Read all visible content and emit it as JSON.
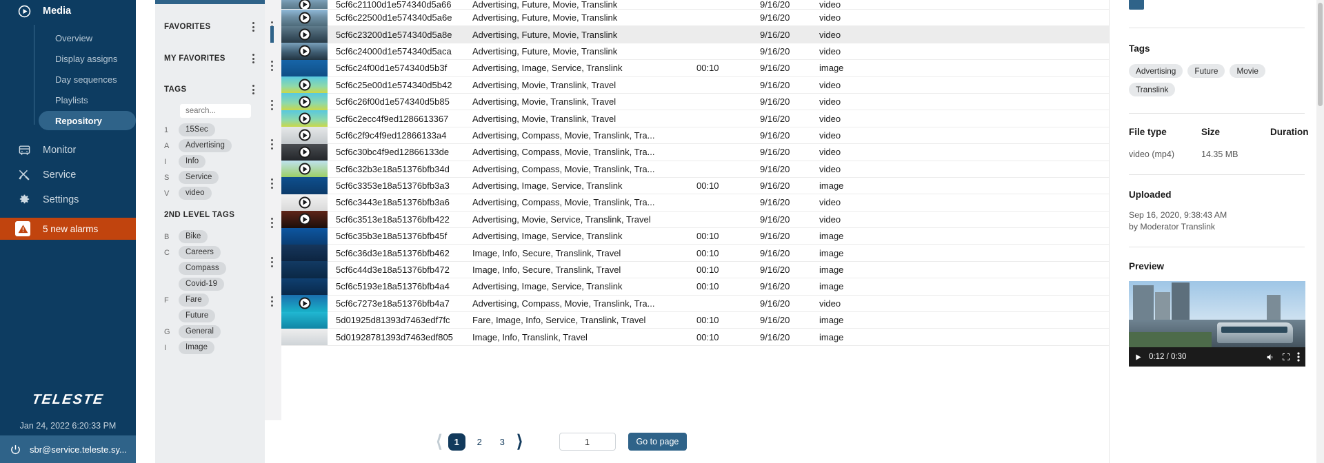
{
  "sidebar": {
    "group": {
      "label": "Media",
      "icon": "play-circle-icon"
    },
    "sub_items": [
      {
        "label": "Overview"
      },
      {
        "label": "Display assigns"
      },
      {
        "label": "Day sequences"
      },
      {
        "label": "Playlists"
      },
      {
        "label": "Repository",
        "active": true
      }
    ],
    "items": [
      {
        "label": "Monitor",
        "icon": "bus-icon"
      },
      {
        "label": "Service",
        "icon": "tools-icon"
      },
      {
        "label": "Settings",
        "icon": "gear-icon"
      }
    ],
    "alarm": {
      "label": "5 new alarms",
      "icon": "warning-icon",
      "color": "#c1440e"
    },
    "brand": "TELESTE",
    "datetime": "Jan 24, 2022  6:20:33 PM",
    "user": "sbr@service.teleste.sy..."
  },
  "tagpanel": {
    "sections": [
      {
        "title": "FAVORITES"
      },
      {
        "title": "MY FAVORITES"
      },
      {
        "title": "TAGS"
      }
    ],
    "search_placeholder": "search...",
    "tags": [
      {
        "letter": "1",
        "label": "15Sec"
      },
      {
        "letter": "A",
        "label": "Advertising"
      },
      {
        "letter": "I",
        "label": "Info"
      },
      {
        "letter": "S",
        "label": "Service"
      },
      {
        "letter": "V",
        "label": "video"
      }
    ],
    "second_level_title": "2ND LEVEL TAGS",
    "second_level_tags": [
      {
        "letter": "B",
        "label": "Bike"
      },
      {
        "letter": "C",
        "label": "Careers"
      },
      {
        "letter": "",
        "label": "Compass"
      },
      {
        "letter": "",
        "label": "Covid-19"
      },
      {
        "letter": "F",
        "label": "Fare"
      },
      {
        "letter": "",
        "label": "Future"
      },
      {
        "letter": "G",
        "label": "General"
      },
      {
        "letter": "I",
        "label": "Image"
      }
    ]
  },
  "list": {
    "rows": [
      {
        "id": "5cf6c21100d1e574340d5a66",
        "tags": "Advertising, Future, Movie, Translink",
        "duration": "",
        "date": "9/16/20",
        "type": "video",
        "thumb": "city-video",
        "selected": false,
        "partial": true
      },
      {
        "id": "5cf6c22500d1e574340d5a6e",
        "tags": "Advertising, Future, Movie, Translink",
        "duration": "",
        "date": "9/16/20",
        "type": "video",
        "thumb": "city-video",
        "selected": false
      },
      {
        "id": "5cf6c23200d1e574340d5a8e",
        "tags": "Advertising, Future, Movie, Translink",
        "duration": "",
        "date": "9/16/20",
        "type": "video",
        "thumb": "bridge-video",
        "selected": true
      },
      {
        "id": "5cf6c24000d1e574340d5aca",
        "tags": "Advertising, Future, Movie, Translink",
        "duration": "",
        "date": "9/16/20",
        "type": "video",
        "thumb": "water-video",
        "selected": false
      },
      {
        "id": "5cf6c24f00d1e574340d5b3f",
        "tags": "Advertising, Image, Service, Translink",
        "duration": "00:10",
        "date": "9/16/20",
        "type": "image",
        "thumb": "blue-poster",
        "selected": false
      },
      {
        "id": "5cf6c25e00d1e574340d5b42",
        "tags": "Advertising, Movie, Translink, Travel",
        "duration": "",
        "date": "9/16/20",
        "type": "video",
        "thumb": "cyan-video",
        "selected": false
      },
      {
        "id": "5cf6c26f00d1e574340d5b85",
        "tags": "Advertising, Movie, Translink, Travel",
        "duration": "",
        "date": "9/16/20",
        "type": "video",
        "thumb": "cyan-video",
        "selected": false
      },
      {
        "id": "5cf6c2ecc4f9ed1286613367",
        "tags": "Advertising, Movie, Translink, Travel",
        "duration": "",
        "date": "9/16/20",
        "type": "video",
        "thumb": "cyan-video",
        "selected": false
      },
      {
        "id": "5cf6c2f9c4f9ed12866133a4",
        "tags": "Advertising, Compass, Movie, Translink, Tra...",
        "duration": "",
        "date": "9/16/20",
        "type": "video",
        "thumb": "grey-video",
        "selected": false
      },
      {
        "id": "5cf6c30bc4f9ed12866133de",
        "tags": "Advertising, Compass, Movie, Translink, Tra...",
        "duration": "",
        "date": "9/16/20",
        "type": "video",
        "thumb": "dark-video",
        "selected": false
      },
      {
        "id": "5cf6c32b3e18a51376bfb34d",
        "tags": "Advertising, Compass, Movie, Translink, Tra...",
        "duration": "",
        "date": "9/16/20",
        "type": "video",
        "thumb": "platform-video",
        "selected": false
      },
      {
        "id": "5cf6c3353e18a51376bfb3a3",
        "tags": "Advertising, Image, Service, Translink",
        "duration": "00:10",
        "date": "9/16/20",
        "type": "image",
        "thumb": "card-poster",
        "selected": false
      },
      {
        "id": "5cf6c3443e18a51376bfb3a6",
        "tags": "Advertising, Compass, Movie, Translink, Tra...",
        "duration": "",
        "date": "9/16/20",
        "type": "video",
        "thumb": "white-video",
        "selected": false
      },
      {
        "id": "5cf6c3513e18a51376bfb422",
        "tags": "Advertising, Movie, Service, Translink, Travel",
        "duration": "",
        "date": "9/16/20",
        "type": "video",
        "thumb": "night-video",
        "selected": false
      },
      {
        "id": "5cf6c35b3e18a51376bfb45f",
        "tags": "Advertising, Image, Service, Translink",
        "duration": "00:10",
        "date": "9/16/20",
        "type": "image",
        "thumb": "map-poster",
        "selected": false
      },
      {
        "id": "5cf6c36d3e18a51376bfb462",
        "tags": "Image, Info, Secure, Translink, Travel",
        "duration": "00:10",
        "date": "9/16/20",
        "type": "image",
        "thumb": "person-poster",
        "selected": false
      },
      {
        "id": "5cf6c44d3e18a51376bfb472",
        "tags": "Image, Info, Secure, Translink, Travel",
        "duration": "00:10",
        "date": "9/16/20",
        "type": "image",
        "thumb": "text-poster",
        "selected": false
      },
      {
        "id": "5cf6c5193e18a51376bfb4a4",
        "tags": "Advertising, Image, Service, Translink",
        "duration": "00:10",
        "date": "9/16/20",
        "type": "image",
        "thumb": "ride-poster",
        "selected": false
      },
      {
        "id": "5cf6c7273e18a51376bfb4a7",
        "tags": "Advertising, Compass, Movie, Translink, Tra...",
        "duration": "",
        "date": "9/16/20",
        "type": "video",
        "thumb": "logo-video",
        "selected": false
      },
      {
        "id": "5d01925d81393d7463edf7fc",
        "tags": "Fare, Image, Info, Service, Translink, Travel",
        "duration": "00:10",
        "date": "9/16/20",
        "type": "image",
        "thumb": "transit-poster",
        "selected": false
      },
      {
        "id": "5d01928781393d7463edf805",
        "tags": "Image, Info, Translink, Travel",
        "duration": "00:10",
        "date": "9/16/20",
        "type": "image",
        "thumb": "service-poster",
        "selected": false
      }
    ]
  },
  "pagination": {
    "prev_icon": "chevron-left-icon",
    "next_icon": "chevron-right-icon",
    "pages": [
      "1",
      "2",
      "3"
    ],
    "active_page": "1",
    "page_input_value": "1",
    "goto_label": "Go to page"
  },
  "detail": {
    "tags_heading": "Tags",
    "tags": [
      "Advertising",
      "Future",
      "Movie",
      "Translink"
    ],
    "meta_headers": [
      "File type",
      "Size",
      "Duration"
    ],
    "meta_values": [
      "video (mp4)",
      "14.35 MB",
      ""
    ],
    "uploaded_heading": "Uploaded",
    "uploaded_date": "Sep 16, 2020, 9:38:43 AM",
    "uploaded_by": "by Moderator Translink",
    "preview_heading": "Preview",
    "player": {
      "play_icon": "play-icon",
      "time": "0:12 / 0:30",
      "volume_icon": "volume-icon",
      "fullscreen_icon": "fullscreen-icon",
      "menu_icon": "kebab-icon"
    }
  },
  "colors": {
    "nav_bg": "#0d3c61",
    "accent": "#2f6389",
    "alarm": "#c1440e",
    "panel_bg": "#eceef0"
  }
}
